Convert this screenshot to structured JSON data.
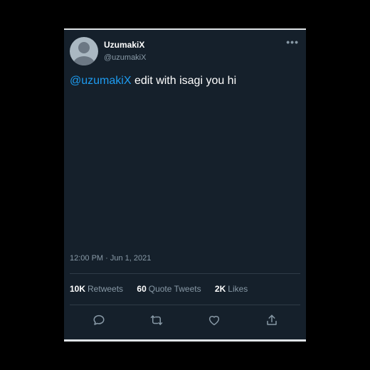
{
  "tweet": {
    "display_name": "UzumakiX",
    "handle": "@uzumakiX",
    "mention": "@uzumakiX",
    "text": " edit with isagi you hi",
    "timestamp": "12:00 PM · Jun 1, 2021",
    "more_icon": "•••"
  },
  "stats": {
    "retweets": {
      "count": "10K",
      "label": "Retweets"
    },
    "quotes": {
      "count": "60",
      "label": "Quote Tweets"
    },
    "likes": {
      "count": "2K",
      "label": "Likes"
    }
  },
  "actions": [
    "reply-icon",
    "retweet-icon",
    "like-icon",
    "share-icon"
  ],
  "colors": {
    "page_background": "#000000",
    "card_background": "#15202b",
    "accent": "#1d9bf0",
    "secondary_text": "#8899a6",
    "divider": "#2f3b47"
  }
}
